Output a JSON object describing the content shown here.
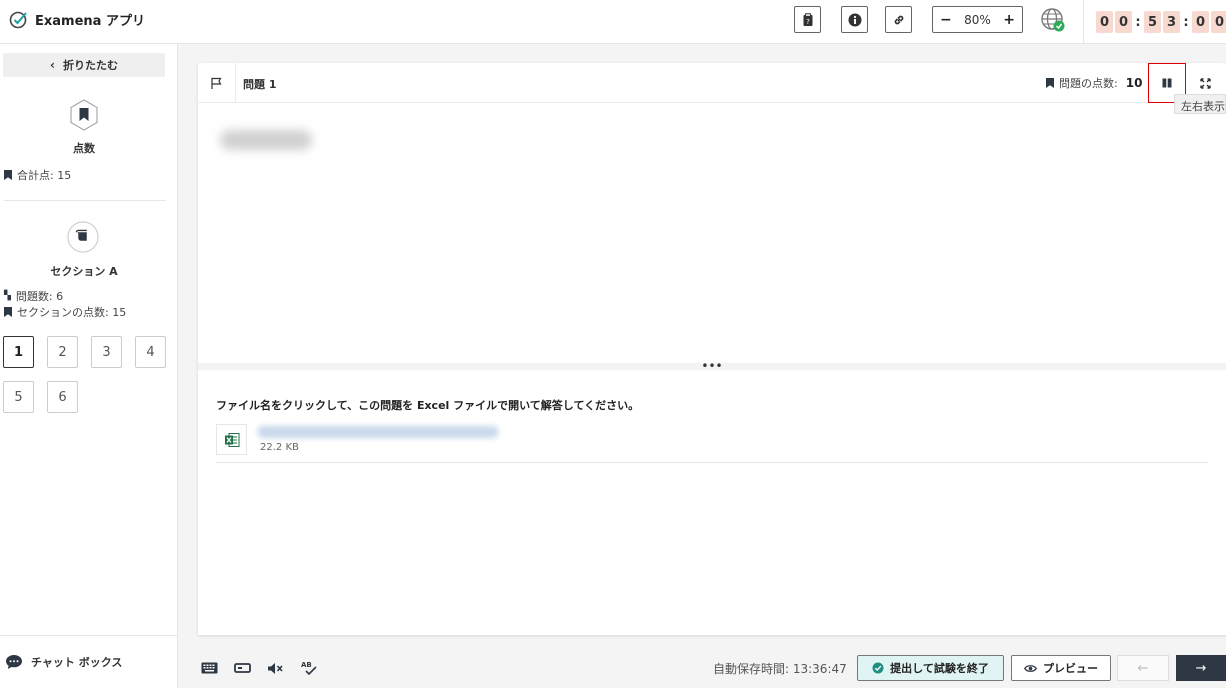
{
  "app": {
    "title": "Examena アプリ"
  },
  "toolbar": {
    "zoom_minus": "−",
    "zoom_value": "80%",
    "zoom_plus": "+"
  },
  "timer": {
    "digits": [
      "0",
      "0",
      "5",
      "3",
      "0",
      "0"
    ],
    "separator": ":"
  },
  "sidebar": {
    "collapse_label": "折りたたむ",
    "points_title": "点数",
    "total_points": "合計点: 15",
    "section_title": "セクション A",
    "question_count": "問題数: 6",
    "section_points": "セクションの点数: 15",
    "questions": [
      "1",
      "2",
      "3",
      "4",
      "5",
      "6"
    ],
    "active_question": "1",
    "chat_label": "チャット ボックス"
  },
  "question": {
    "title": "問題 1",
    "points_label": "問題の点数:",
    "points_value": "10",
    "split_tooltip": "左右表示",
    "splitter_handle": "•••",
    "instruction": "ファイル名をクリックして、この問題を Excel ファイルで開いて解答してください。",
    "file_size": "22.2 KB"
  },
  "footer": {
    "autosave": "自動保存時間: 13:36:47",
    "submit_label": "提出して試験を終了",
    "preview_label": "プレビュー",
    "prev_arrow": "←",
    "next_arrow": "→"
  },
  "colors": {
    "accent": "#2e3744",
    "submit_bg": "#e0f5f3",
    "timer_bg": "#f8d9d0",
    "highlight": "#dd0000"
  }
}
